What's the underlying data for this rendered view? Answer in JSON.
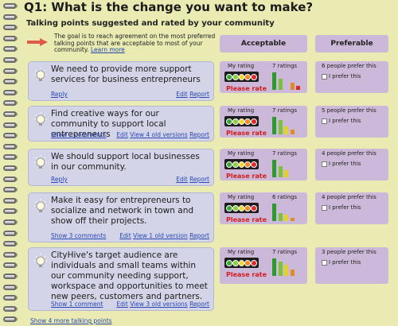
{
  "header": {
    "title": "Q1: What is the change you want to make?",
    "subtitle": "Talking points suggested and rated by your community",
    "goal_text": "The goal is to reach agreement on the most preferred talking points that are acceptable to most of your community. ",
    "learn_more": "Learn more"
  },
  "columns": {
    "acceptable": "Acceptable",
    "preferable": "Preferable"
  },
  "common": {
    "my_rating": "My rating",
    "please_rate": "Please rate",
    "i_prefer": "I prefer this",
    "edit": "Edit",
    "report": "Report"
  },
  "points": [
    {
      "text": "We need to provide more support services for business entrepreneurs",
      "left_link": "Reply",
      "old_versions": "",
      "ratings": "7 ratings",
      "prefer_count": "6 people prefer this",
      "rating_levels": [
        0.85,
        0.55,
        0.0,
        0.35,
        0.2
      ]
    },
    {
      "text": "Find creative ways for our community to support local entrepreneurs",
      "left_link": "Show 2 comments",
      "old_versions": "View 4 old versions",
      "ratings": "7 ratings",
      "prefer_count": "5 people prefer this",
      "rating_levels": [
        0.85,
        0.7,
        0.4,
        0.25,
        0.0
      ]
    },
    {
      "text": "We should support local businesses in our community.",
      "left_link": "Reply",
      "old_versions": "",
      "ratings": "7 ratings",
      "prefer_count": "4 people prefer this",
      "rating_levels": [
        0.85,
        0.55,
        0.35,
        0.0,
        0.0
      ]
    },
    {
      "text": "Make it easy for entrepreneurs to socialize and network in town and show off their projects.",
      "left_link": "Show 3 comments",
      "old_versions": "View 1 old version",
      "ratings": "6 ratings",
      "prefer_count": "4 people prefer this",
      "rating_levels": [
        0.85,
        0.4,
        0.3,
        0.15,
        0.0
      ]
    },
    {
      "text": "CityHive's target audience are individuals and small teams within our community needing support, workspace and opportunities to meet new peers, customers and partners.",
      "left_link": "Show 1 comment",
      "old_versions": "View 3 old versions",
      "ratings": "7 ratings",
      "prefer_count": "3 people prefer this",
      "rating_levels": [
        0.85,
        0.7,
        0.55,
        0.3,
        0.0
      ]
    }
  ],
  "footer": {
    "more_link": "Show 4 more talking points"
  },
  "colors": {
    "background": "#e9ebb3",
    "card": "#d3d4e7",
    "rating_panel": "#ccb8d8",
    "link": "#2a48b3",
    "please_rate": "#d21d1d",
    "bar_colors": [
      "#2e9a2e",
      "#7cc13a",
      "#e3d224",
      "#e08c26",
      "#d42a2a"
    ],
    "light_colors": [
      "#3aa83a",
      "#8ccf3c",
      "#f1d927",
      "#f08a24",
      "#e02a2a"
    ]
  },
  "icons": {
    "bulb": "lightbulb-icon",
    "arrow": "arrow-right-icon"
  }
}
